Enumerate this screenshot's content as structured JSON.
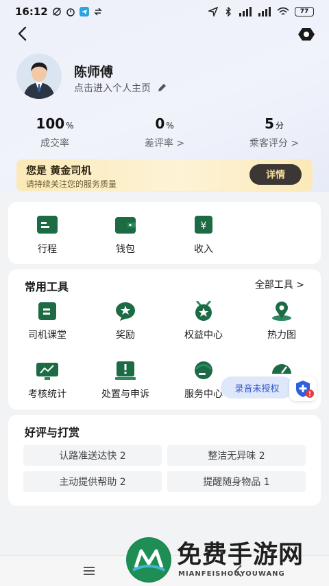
{
  "statusbar": {
    "time": "16:12",
    "battery": "77"
  },
  "profile": {
    "name": "陈师傅",
    "subtitle": "点击进入个人主页"
  },
  "stats": [
    {
      "value": "100",
      "unit": "%",
      "label": "成交率"
    },
    {
      "value": "0",
      "unit": "%",
      "label": "差评率 >"
    },
    {
      "value": "5",
      "unit": "分",
      "label": "乘客评分 >"
    }
  ],
  "gold_banner": {
    "title": "您是 黄金司机",
    "subtitle": "请持续关注您的服务质量",
    "button": "详情"
  },
  "quick_actions": [
    {
      "label": "行程",
      "icon": "itinerary-icon"
    },
    {
      "label": "钱包",
      "icon": "wallet-icon"
    },
    {
      "label": "收入",
      "icon": "income-icon"
    }
  ],
  "tools": {
    "title": "常用工具",
    "all_link": "全部工具 >",
    "items": [
      {
        "label": "司机课堂",
        "icon": "classroom-icon"
      },
      {
        "label": "奖励",
        "icon": "reward-icon"
      },
      {
        "label": "权益中心",
        "icon": "benefits-icon"
      },
      {
        "label": "热力图",
        "icon": "heatmap-icon"
      },
      {
        "label": "考核统计",
        "icon": "assessment-icon"
      },
      {
        "label": "处置与申诉",
        "icon": "appeal-icon"
      },
      {
        "label": "服务中心",
        "icon": "service-icon"
      },
      {
        "label": "",
        "icon": "speed-icon"
      }
    ]
  },
  "reviews": {
    "title": "好评与打赏",
    "tags": [
      "认路准送达快 2",
      "整洁无异味 2",
      "主动提供帮助 2",
      "提醒随身物品 1"
    ]
  },
  "recording_chip": "录音未授权",
  "watermark": {
    "text": "免费手游网",
    "sub": "MIANFEISHOUYOUWANG"
  },
  "colors": {
    "accent_green": "#1d6b45",
    "gold_button": "#3c3734",
    "chip_blue": "#3557c9"
  }
}
